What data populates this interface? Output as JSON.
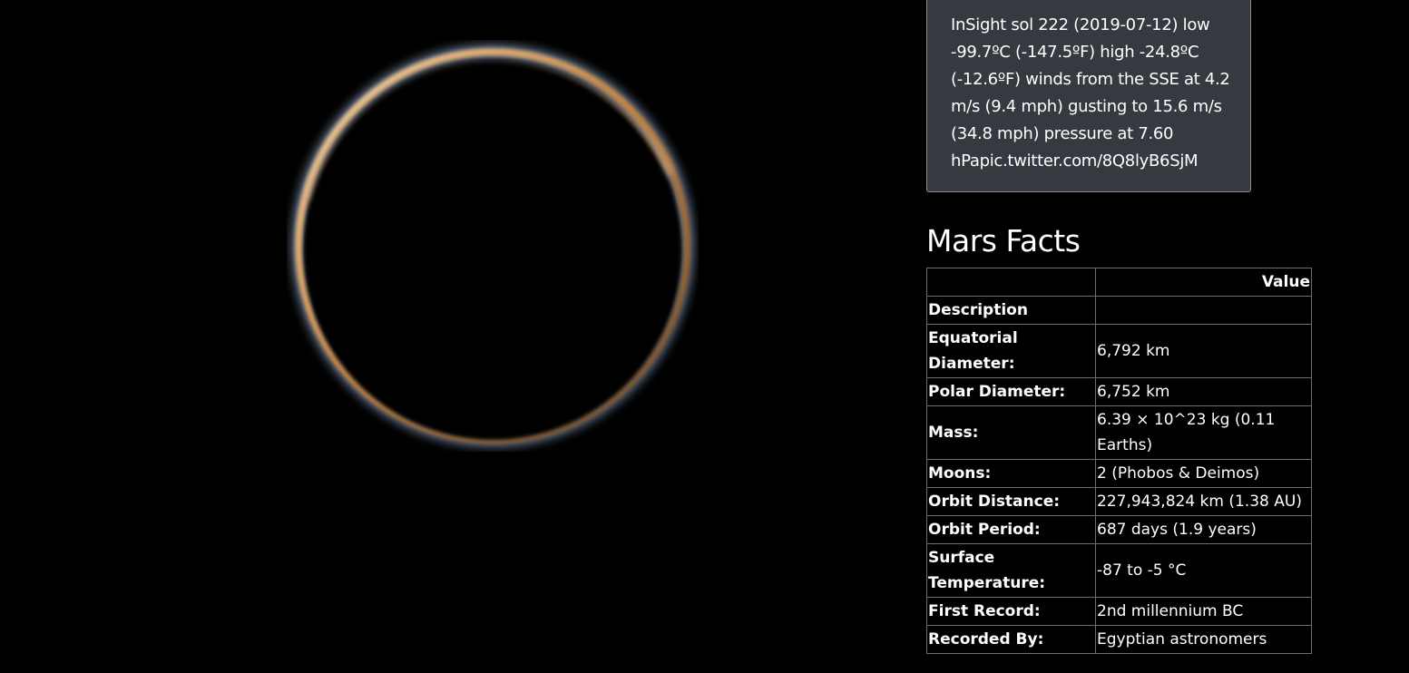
{
  "featured_image": {
    "description_icon": "planet-ring-silhouette"
  },
  "weather": {
    "text": "InSight sol 222 (2019-07-12) low -99.7ºC (-147.5ºF) high -24.8ºC (-12.6ºF) winds from the SSE at 4.2 m/s (9.4 mph) gusting to 15.6 m/s (34.8 mph) pressure at 7.60 hPapic.twitter.com/8Q8lyB6SjM"
  },
  "facts": {
    "title": "Mars Facts",
    "header": {
      "blank": "",
      "value": "Value"
    },
    "rows": [
      {
        "label": "Description",
        "value": ""
      },
      {
        "label": "Equatorial Diameter:",
        "value": "6,792 km"
      },
      {
        "label": "Polar Diameter:",
        "value": "6,752 km"
      },
      {
        "label": "Mass:",
        "value": "6.39 × 10^23 kg (0.11 Earths)"
      },
      {
        "label": "Moons:",
        "value": "2 (Phobos & Deimos)"
      },
      {
        "label": "Orbit Distance:",
        "value": "227,943,824 km (1.38 AU)"
      },
      {
        "label": "Orbit Period:",
        "value": "687 days (1.9 years)"
      },
      {
        "label": "Surface Temperature:",
        "value": "-87 to -5 °C"
      },
      {
        "label": "First Record:",
        "value": "2nd millennium BC"
      },
      {
        "label": "Recorded By:",
        "value": "Egyptian astronomers"
      }
    ]
  },
  "colors": {
    "background": "#000000",
    "card": "#343a40",
    "table_border": "#6e6e6e",
    "ring_inner": "#f2c28a",
    "ring_outer": "#8fa6c8"
  }
}
